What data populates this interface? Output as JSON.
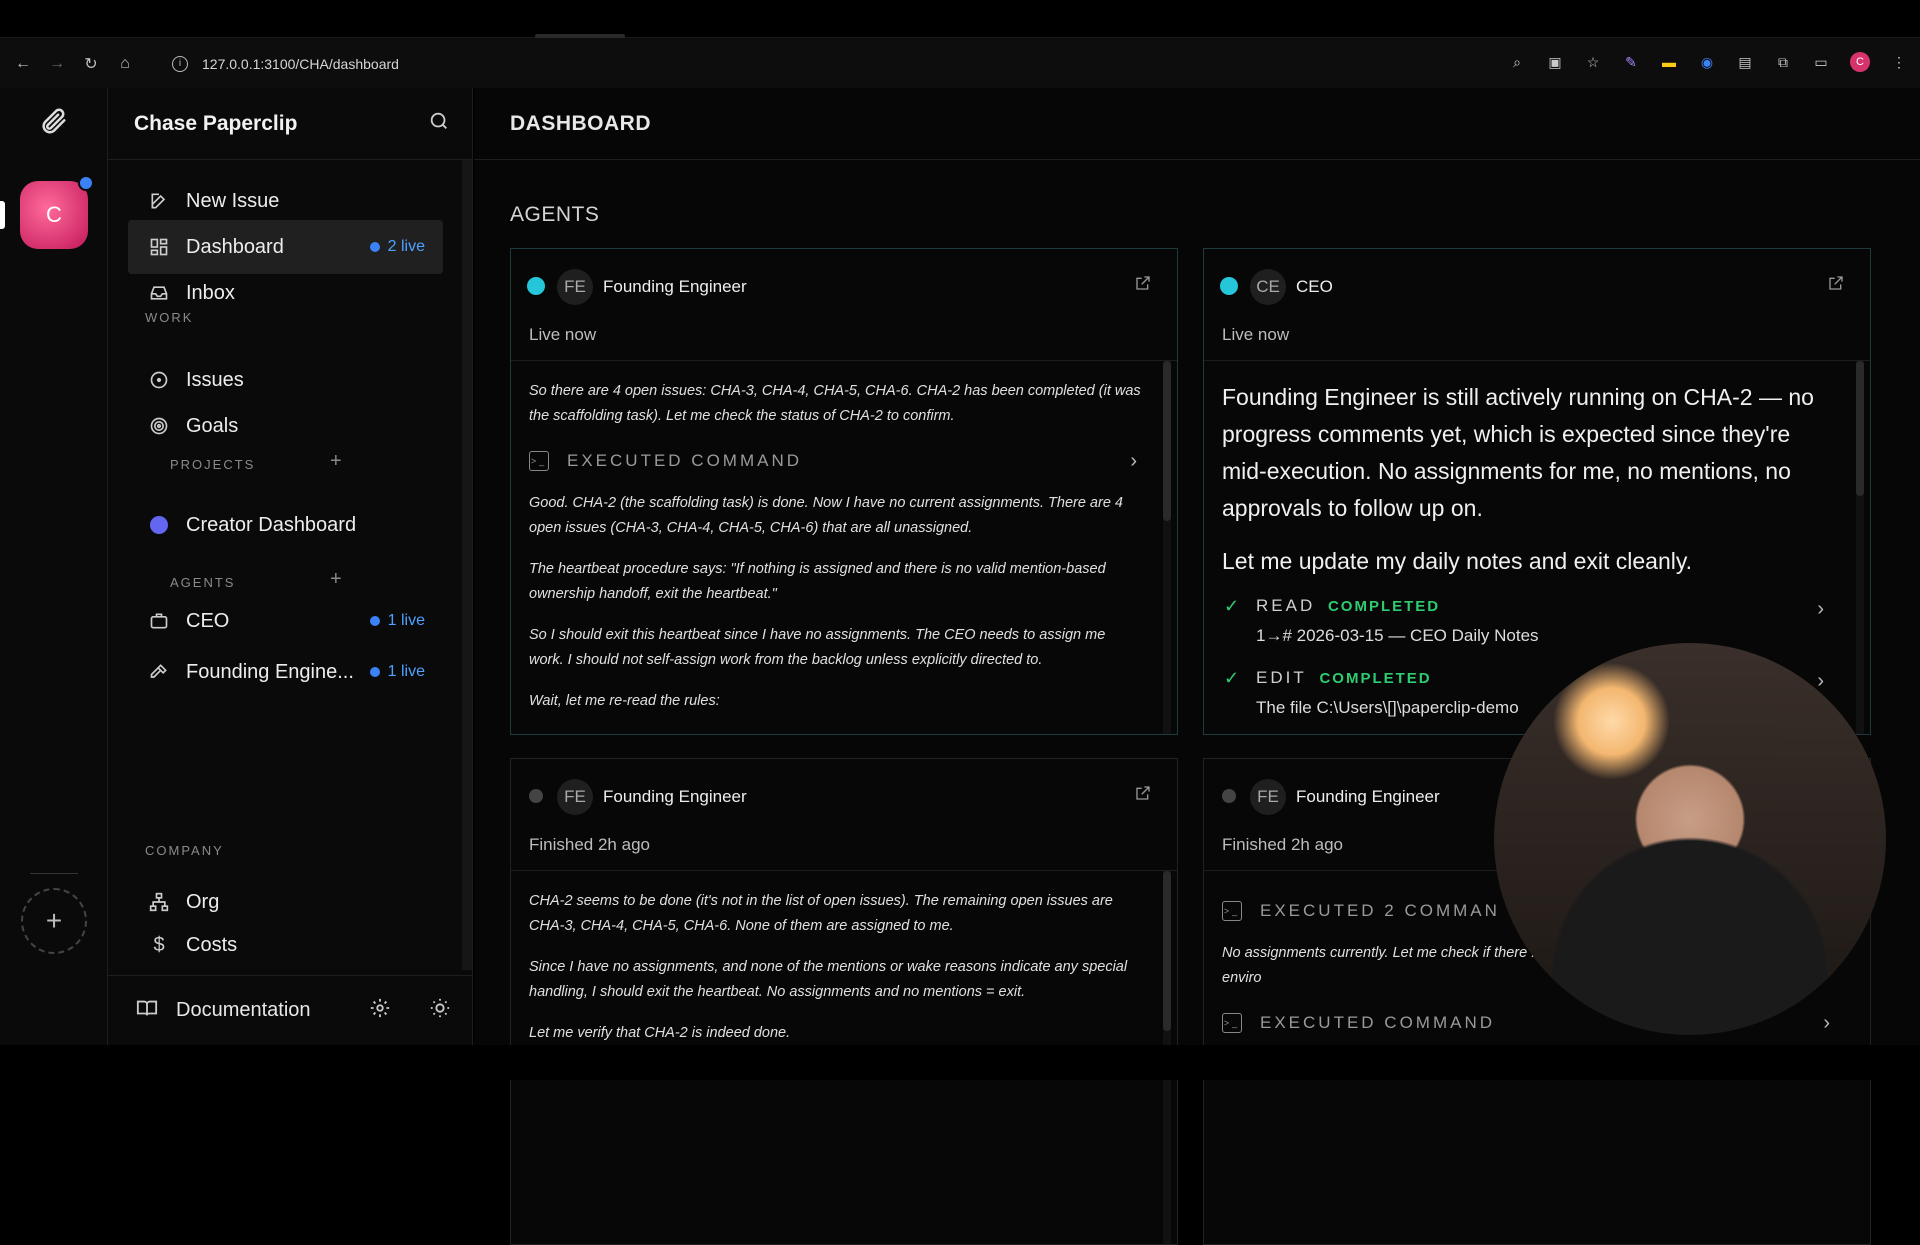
{
  "browser": {
    "url": "127.0.0.1:3100/CHA/dashboard",
    "profile_initial": "C"
  },
  "rail": {
    "company_initial": "C"
  },
  "sidebar": {
    "title": "Chase Paperclip",
    "new_issue": "New Issue",
    "dashboard": "Dashboard",
    "dashboard_live": "2 live",
    "inbox": "Inbox",
    "work_label": "WORK",
    "issues": "Issues",
    "goals": "Goals",
    "projects_label": "PROJECTS",
    "project_1": "Creator Dashboard",
    "project_1_color": "#6366f1",
    "agents_label": "AGENTS",
    "agent_ceo": "CEO",
    "agent_ceo_live": "1 live",
    "agent_fe": "Founding Engine...",
    "agent_fe_live": "1 live",
    "company_label": "COMPANY",
    "org": "Org",
    "costs": "Costs",
    "documentation": "Documentation"
  },
  "main": {
    "page_title": "DASHBOARD",
    "agents_section": "AGENTS"
  },
  "cards": [
    {
      "initials": "FE",
      "name": "Founding Engineer",
      "status": "Live now",
      "p1": "So there are 4 open issues: CHA-3, CHA-4, CHA-5, CHA-6. CHA-2 has been completed (it was the scaffolding task). Let me check the status of CHA-2 to confirm.",
      "cmd": "EXECUTED COMMAND",
      "p2": "Good. CHA-2 (the scaffolding task) is done. Now I have no current assignments. There are 4 open issues (CHA-3, CHA-4, CHA-5, CHA-6) that are all unassigned.",
      "p3": "The heartbeat procedure says: \"If nothing is assigned and there is no valid mention-based ownership handoff, exit the heartbeat.\"",
      "p4": "So I should exit this heartbeat since I have no assignments. The CEO needs to assign me work. I should not self-assign work from the backlog unless explicitly directed to.",
      "p5": "Wait, let me re-read the rules:"
    },
    {
      "initials": "CE",
      "name": "CEO",
      "status": "Live now",
      "p1": "Founding Engineer is still actively running on CHA-2 — no progress comments yet, which is expected since they're mid-execution. No assignments for me, no mentions, no approvals to follow up on.",
      "p2": "Let me update my daily notes and exit cleanly.",
      "tool1_name": "READ",
      "tool1_status": "COMPLETED",
      "tool1_detail": "1→# 2026-03-15 — CEO Daily Notes",
      "tool2_name": "EDIT",
      "tool2_status": "COMPLETED",
      "tool2_detail": "The file C:\\Users\\[]\\paperclip-demo"
    },
    {
      "initials": "FE",
      "name": "Founding Engineer",
      "status": "Finished 2h ago",
      "p1": "CHA-2 seems to be done (it's not in the list of open issues). The remaining open issues are CHA-3, CHA-4, CHA-5, CHA-6. None of them are assigned to me.",
      "p2": "Since I have no assignments, and none of the mentions or wake reasons indicate any special handling, I should exit the heartbeat. No assignments and no mentions = exit.",
      "p3": "Let me verify that CHA-2 is indeed done."
    },
    {
      "initials": "FE",
      "name": "Founding Engineer",
      "status": "Finished 2h ago",
      "cmd1": "EXECUTED 2 COMMAN",
      "p1": "No assignments currently. Let me check if there PAPERCLIP_WAKE_COMMENT_ID set in the enviro",
      "cmd2": "EXECUTED COMMAND"
    }
  ]
}
